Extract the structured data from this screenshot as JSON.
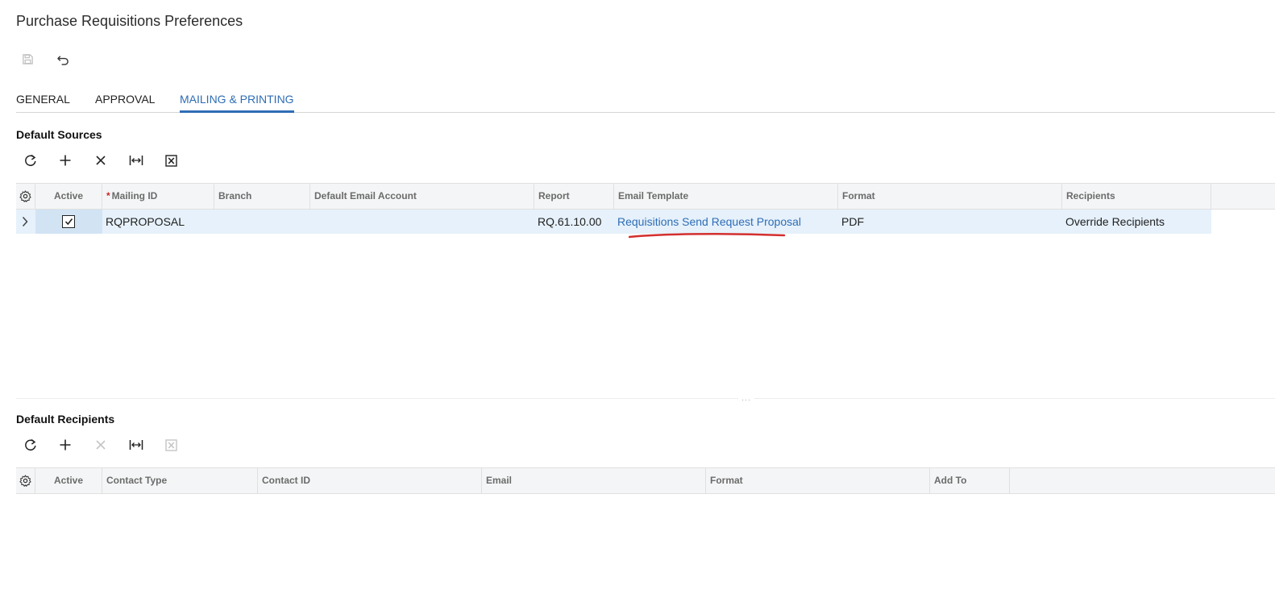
{
  "page": {
    "title": "Purchase Requisitions Preferences"
  },
  "toolbar": {
    "save_icon": "save-icon",
    "undo_icon": "undo-icon"
  },
  "tabs": [
    {
      "label": "GENERAL",
      "active": false
    },
    {
      "label": "APPROVAL",
      "active": false
    },
    {
      "label": "MAILING & PRINTING",
      "active": true
    }
  ],
  "sources": {
    "title": "Default Sources",
    "toolbar": [
      "refresh-icon",
      "add-icon",
      "delete-icon",
      "fit-columns-icon",
      "export-excel-icon"
    ],
    "columns": {
      "active": "Active",
      "mailing_required": "*",
      "mailing_id": "Mailing ID",
      "branch": "Branch",
      "email_account": "Default Email Account",
      "report": "Report",
      "email_template": "Email Template",
      "format": "Format",
      "recipients": "Recipients"
    },
    "rows": [
      {
        "active": true,
        "mailing_id": "RQPROPOSAL",
        "branch": "",
        "email_account": "",
        "report": "RQ.61.10.00",
        "email_template": "Requisitions Send Request Proposal",
        "format": "PDF",
        "recipients": "Override Recipients"
      }
    ]
  },
  "splitter": {
    "handle": "..."
  },
  "recipients": {
    "title": "Default Recipients",
    "toolbar": [
      "refresh-icon",
      "add-icon",
      "delete-icon",
      "fit-columns-icon",
      "export-excel-icon"
    ],
    "columns": {
      "active": "Active",
      "contact_type": "Contact Type",
      "contact_id": "Contact ID",
      "email": "Email",
      "format": "Format",
      "add_to": "Add To"
    },
    "rows": []
  },
  "colors": {
    "accent": "#2f6db5",
    "selected_row": "#e6f1fb",
    "header_bg": "#f4f5f6",
    "annotation": "#d32f2f"
  }
}
